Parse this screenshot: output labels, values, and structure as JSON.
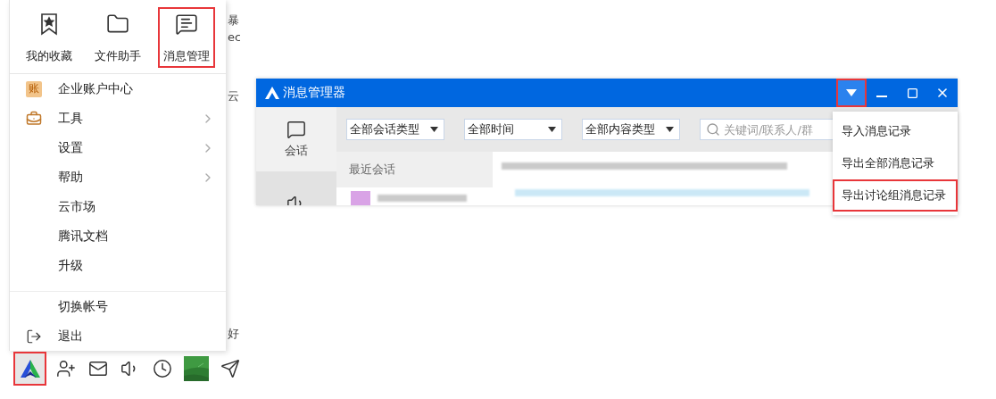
{
  "side_menu": {
    "shortcuts": [
      {
        "label": "我的收藏",
        "kind": "bookmark",
        "highlighted": false
      },
      {
        "label": "文件助手",
        "kind": "folder",
        "highlighted": false
      },
      {
        "label": "消息管理",
        "kind": "message",
        "highlighted": true
      }
    ],
    "items": [
      {
        "label": "企业账户中心",
        "kind": "ledger",
        "icon_text": "账",
        "has_submenu": false,
        "divider_before": false
      },
      {
        "label": "工具",
        "kind": "toolbox",
        "has_submenu": true,
        "divider_before": false
      },
      {
        "label": "设置",
        "kind": "plain",
        "has_submenu": true,
        "divider_before": false
      },
      {
        "label": "帮助",
        "kind": "plain",
        "has_submenu": true,
        "divider_before": false
      },
      {
        "label": "云市场",
        "kind": "plain",
        "has_submenu": false,
        "divider_before": false
      },
      {
        "label": "腾讯文档",
        "kind": "plain",
        "has_submenu": false,
        "divider_before": false
      },
      {
        "label": "升级",
        "kind": "plain",
        "has_submenu": false,
        "divider_before": false
      },
      {
        "label": "切换帐号",
        "kind": "plain",
        "has_submenu": false,
        "divider_before": true
      },
      {
        "label": "退出",
        "kind": "exit",
        "has_submenu": false,
        "divider_before": false
      }
    ]
  },
  "background_fragments": [
    "暴",
    "ec",
    "云",
    "好"
  ],
  "toolbar": {
    "items": [
      {
        "kind": "logo",
        "highlighted": true
      },
      {
        "kind": "add-contact",
        "highlighted": false
      },
      {
        "kind": "mail",
        "highlighted": false
      },
      {
        "kind": "speaker",
        "highlighted": false
      },
      {
        "kind": "clock",
        "highlighted": false
      },
      {
        "kind": "picture",
        "highlighted": false
      },
      {
        "kind": "send",
        "highlighted": false
      }
    ]
  },
  "manager_window": {
    "title": "消息管理器",
    "title_buttons": [
      {
        "kind": "menu",
        "highlighted": true
      },
      {
        "kind": "minimize",
        "highlighted": false
      },
      {
        "kind": "maximize",
        "highlighted": false
      },
      {
        "kind": "close",
        "highlighted": false
      }
    ],
    "nav": [
      {
        "label": "会话",
        "kind": "chat",
        "selected": true
      },
      {
        "kind": "speaker",
        "selected": false
      }
    ],
    "filters": [
      {
        "value": "全部会话类型"
      },
      {
        "value": "全部时间"
      },
      {
        "value": "全部内容类型"
      }
    ],
    "search": {
      "placeholder": "关键词/联系人/群"
    },
    "list_header": "最近会话",
    "dropdown_menu": [
      {
        "label": "导入消息记录",
        "highlighted": false
      },
      {
        "label": "导出全部消息记录",
        "highlighted": false
      },
      {
        "label": "导出讨论组消息记录",
        "highlighted": true
      }
    ]
  }
}
